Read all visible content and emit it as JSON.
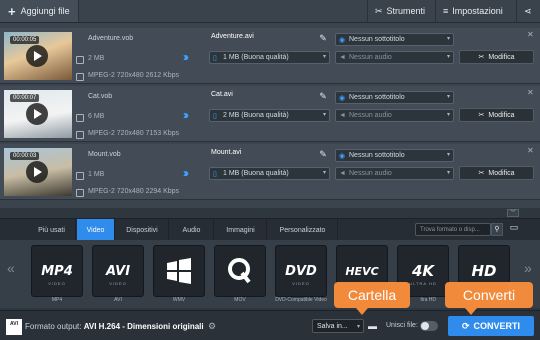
{
  "toolbar": {
    "add_files": "Aggiungi file",
    "tools": "Strumenti",
    "settings": "Impostazioni"
  },
  "files": [
    {
      "timecode": "00:00:05",
      "source_name": "Adventure.vob",
      "source_size": "2 MB",
      "source_info": "MPEG-2 720x480 2612 Kbps",
      "output_name": "Adventure.avi",
      "output_size": "1 MB (Buona qualità)",
      "subtitle": "Nessun sottotitolo",
      "audio": "Nessun audio",
      "edit": "Modifica"
    },
    {
      "timecode": "00:00:07",
      "source_name": "Cat.vob",
      "source_size": "6 MB",
      "source_info": "MPEG-2 720x480 7153 Kbps",
      "output_name": "Cat.avi",
      "output_size": "2 MB (Buona qualità)",
      "subtitle": "Nessun sottotitolo",
      "audio": "Nessun audio",
      "edit": "Modifica"
    },
    {
      "timecode": "00:00:03",
      "source_name": "Mount.vob",
      "source_size": "1 MB",
      "source_info": "MPEG-2 720x480 2294 Kbps",
      "output_name": "Mount.avi",
      "output_size": "1 MB (Buona qualità)",
      "subtitle": "Nessun sottotitolo",
      "audio": "Nessun audio",
      "edit": "Modifica"
    }
  ],
  "tabs": [
    "Più usati",
    "Video",
    "Dispositivi",
    "Audio",
    "Immagini",
    "Personalizzato"
  ],
  "active_tab": "Video",
  "search_placeholder": "Trova formato o disp...",
  "formats": [
    {
      "logo": "MP4",
      "sub": "VIDEO",
      "label": "MP4"
    },
    {
      "logo": "AVI",
      "sub": "VIDEO",
      "label": "AVI"
    },
    {
      "logo": "",
      "sub": "",
      "label": "WMV"
    },
    {
      "logo": "",
      "sub": "",
      "label": "MOV"
    },
    {
      "logo": "DVD",
      "sub": "VIDEO",
      "label": "DVD-Compatible Video"
    },
    {
      "logo": "HEVC",
      "sub": "",
      "label": ""
    },
    {
      "logo": "4K",
      "sub": "ULTRA HD",
      "label": ""
    },
    {
      "logo": "HD",
      "sub": "",
      "label": "ltra HD"
    }
  ],
  "bottom": {
    "output_prefix": "Formato output:",
    "output_format": "AVI H.264 - Dimensioni originali",
    "save_to": "Salva in...",
    "merge": "Unisci file:",
    "convert": "CONVERTI",
    "icon_text": "AVI"
  },
  "callouts": {
    "folder": "Cartella",
    "convert": "Converti"
  },
  "colors": {
    "accent": "#2f8cec",
    "callout": "#f28a3b"
  }
}
